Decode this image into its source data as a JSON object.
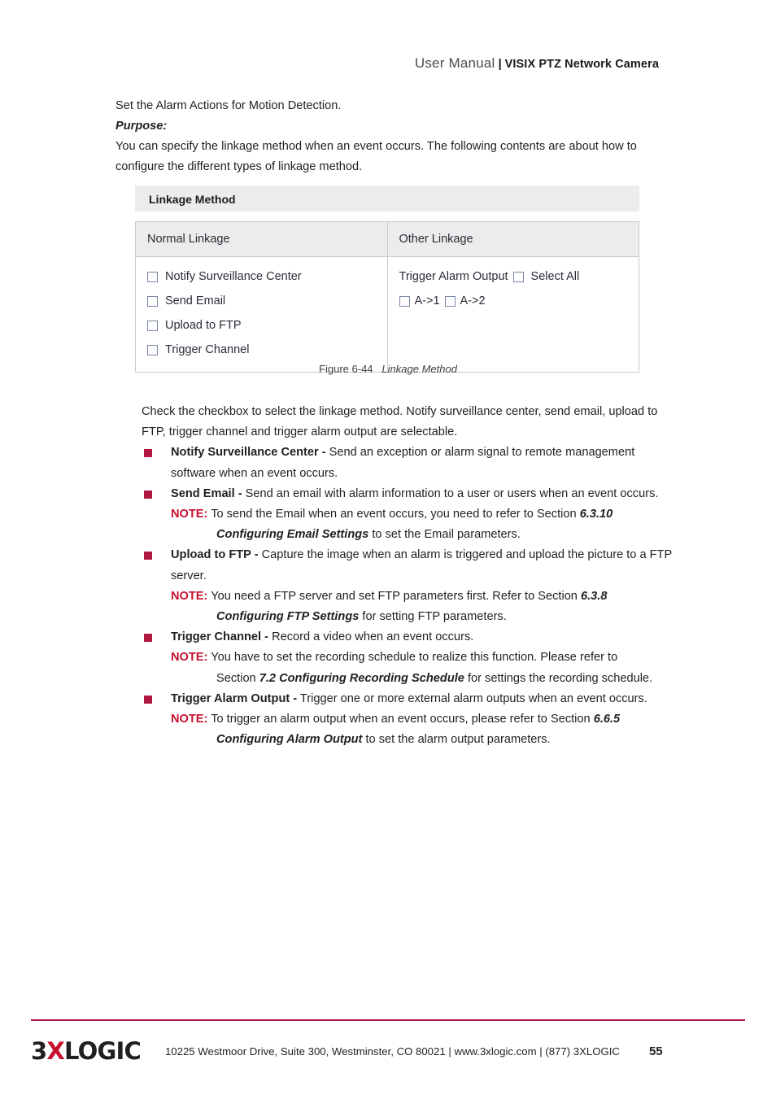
{
  "header": {
    "main": "User Manual",
    "separator": "|",
    "subtitle": "VISIX PTZ Network Camera"
  },
  "intro": {
    "line1": "Set the Alarm Actions for Motion Detection.",
    "purpose_label": "Purpose:",
    "purpose_text": "You can specify the linkage method when an event occurs. The following contents are about how to configure the different types of linkage method."
  },
  "figure": {
    "panel_title": "Linkage Method",
    "columns": {
      "normal": "Normal Linkage",
      "other": "Other Linkage"
    },
    "normal_linkage_options": [
      "Notify Surveillance Center",
      "Send Email",
      "Upload to FTP",
      "Trigger Channel"
    ],
    "other_linkage": {
      "trigger_alarm_output_label": "Trigger Alarm Output",
      "select_all_label": "Select All",
      "outputs": [
        "A->1",
        "A->2"
      ]
    },
    "caption_number": "Figure 6-44",
    "caption_name": "Linkage Method"
  },
  "body": {
    "intro_paragraph": "Check the checkbox to select the linkage method. Notify surveillance center, send email, upload to FTP, trigger channel and trigger alarm output are selectable.",
    "bullets": [
      {
        "term": "Notify Surveillance Center -",
        "text": " Send an exception or alarm signal to remote management software when an event occurs.",
        "note_label": "",
        "note_text": "",
        "note_ref": "",
        "note_sub_ref": "",
        "note_sub_text": ""
      },
      {
        "term": "Send Email -",
        "text": " Send an email with alarm information to a user or users when an event occurs.",
        "note_label": "NOTE:",
        "note_text": " To send the Email when an event occurs, you need to refer to Section ",
        "note_ref": "6.3.10",
        "note_sub_ref": "Configuring Email Settings",
        "note_sub_text": " to set the Email parameters."
      },
      {
        "term": "Upload to FTP -",
        "text": " Capture the image when an alarm is triggered and upload the picture to a FTP server.",
        "note_label": "NOTE:",
        "note_text": " You need a FTP server and set FTP parameters first. Refer to Section ",
        "note_ref": "6.3.8",
        "note_sub_ref": "Configuring FTP Settings",
        "note_sub_text": " for setting FTP parameters."
      },
      {
        "term": "Trigger Channel -",
        "text": " Record a video when an event occurs.",
        "note_label": "NOTE:",
        "note_text": " You have to set the recording schedule to realize this function. Please refer to",
        "note_ref": "",
        "note_sub_prefix": "Section ",
        "note_sub_ref": "7.2 Configuring Recording Schedule",
        "note_sub_text": " for settings the recording schedule."
      },
      {
        "term": "Trigger Alarm Output -",
        "text": " Trigger one or more external alarm outputs when an event occurs.",
        "note_label": "NOTE:",
        "note_text": " To trigger an alarm output when an event occurs, please refer to Section ",
        "note_ref": "6.6.5",
        "note_sub_ref": "Configuring Alarm Output",
        "note_sub_text": " to set the alarm output parameters."
      }
    ]
  },
  "footer": {
    "logo_part1": "3",
    "logo_x": "X",
    "logo_part2": "LOGIC",
    "address": "10225 Westmoor Drive, Suite 300, Westminster, CO 80021 | www.3xlogic.com | (877) 3XLOGIC",
    "page_number": "55"
  },
  "colors": {
    "accent_red": "#c8102e",
    "bullet_red": "#b01842",
    "panel_gray": "#ececec"
  }
}
